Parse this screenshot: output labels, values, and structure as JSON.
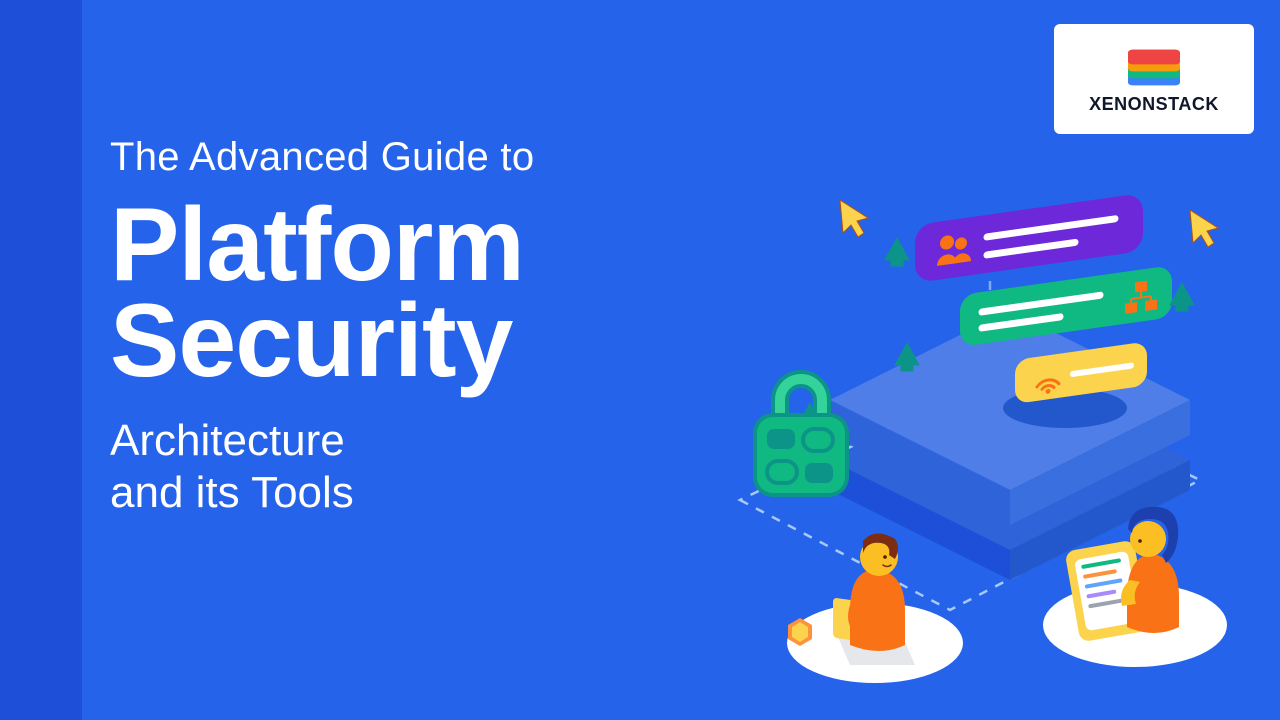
{
  "overline": "The Advanced Guide to",
  "title_line1": "Platform",
  "title_line2": "Security",
  "subtitle_line1": "Architecture",
  "subtitle_line2": "and its Tools",
  "brand": "XENONSTACK",
  "colors": {
    "bg": "#2563eb",
    "bg_dark": "#1e4fd8",
    "white": "#ffffff",
    "purple": "#6d28d9",
    "green_card": "#10b981",
    "yellow_card": "#fcd34d",
    "lock_green": "#0d9488",
    "lock_light": "#34d399",
    "orange": "#f97316",
    "blue_hair": "#1e40af",
    "cursor_yellow": "#fcd34d",
    "arrow_green": "#0d9488"
  }
}
